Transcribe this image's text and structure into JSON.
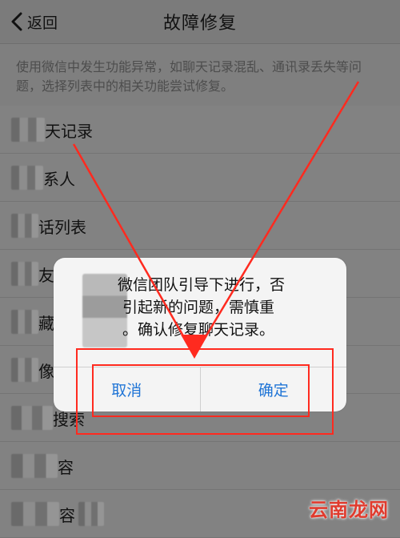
{
  "nav": {
    "back_label": "返回",
    "title": "故障修复"
  },
  "description": "使用微信中发生功能异常，如聊天记录混乱、通讯录丢失等问题，选择列表中的相关功能尝试修复。",
  "list_items": [
    {
      "visible_text": "天记录"
    },
    {
      "visible_text": "系人"
    },
    {
      "visible_text": "话列表"
    },
    {
      "visible_text": "友圈"
    },
    {
      "visible_text": "藏"
    },
    {
      "visible_text": "像"
    },
    {
      "visible_text": "搜索"
    },
    {
      "visible_text": "容"
    },
    {
      "visible_text": "容"
    }
  ],
  "dialog": {
    "line1": "微信团队引导下进行，否",
    "line2": "引起新的问题，需慎重",
    "line3": "。确认修复聊天记录。",
    "cancel_label": "取消",
    "confirm_label": "确定"
  },
  "watermark": "云南龙网",
  "colors": {
    "annotation": "#ff2a1f",
    "button_text": "#1f74d6"
  }
}
